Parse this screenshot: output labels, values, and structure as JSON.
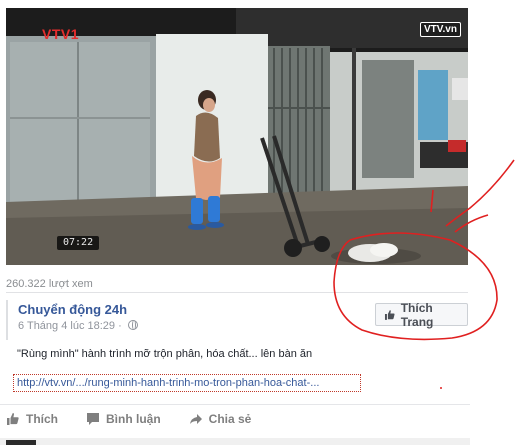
{
  "video": {
    "channel_logo_left": "VTV1",
    "channel_logo_right": "VTV.vn",
    "time": "07:22"
  },
  "views": "260.322 lượt xem",
  "page": {
    "name": "Chuyển động 24h",
    "date": "6 Tháng 4 lúc 18:29 · ",
    "privacy_icon": "globe-icon",
    "like_button_label": "Thích Trang"
  },
  "post": {
    "text": "\"Rùng mình\" hành trình mỡ trộn phân, hóa chất... lên bàn ăn",
    "link": "http://vtv.vn/.../rung-minh-hanh-trinh-mo-tron-phan-hoa-chat-..."
  },
  "actions": [
    {
      "label": "Thích",
      "icon": "thumbs-up-icon"
    },
    {
      "label": "Bình luận",
      "icon": "comment-icon"
    },
    {
      "label": "Chia sẻ",
      "icon": "share-icon"
    }
  ],
  "colors": {
    "link_blue": "#365899",
    "annotation_red": "#e02020"
  }
}
